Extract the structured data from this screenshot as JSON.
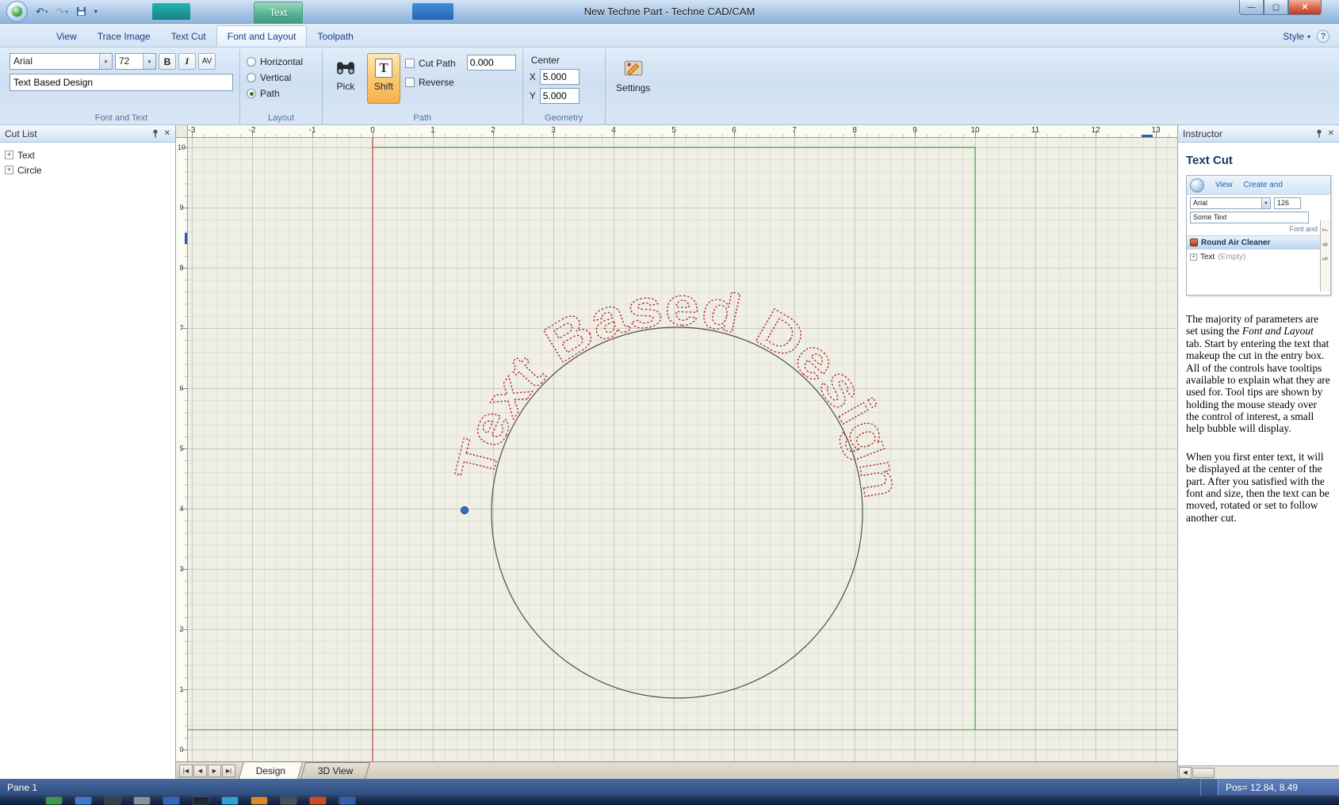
{
  "window": {
    "title": "New Techne Part - Techne CAD/CAM",
    "contextual_tab": "Text",
    "style_label": "Style"
  },
  "ribbon": {
    "tabs": [
      {
        "label": "View",
        "active": false
      },
      {
        "label": "Trace Image",
        "active": false
      },
      {
        "label": "Text Cut",
        "active": false
      },
      {
        "label": "Font and Layout",
        "active": true
      },
      {
        "label": "Toolpath",
        "active": false
      }
    ],
    "font_group": {
      "label": "Font and Text",
      "font_name": "Arial",
      "font_size": "72",
      "bold": "B",
      "italic": "I",
      "kern": "AV",
      "text_value": "Text Based Design"
    },
    "layout_group": {
      "label": "Layout",
      "options": [
        {
          "label": "Horizontal",
          "selected": false
        },
        {
          "label": "Vertical",
          "selected": false
        },
        {
          "label": "Path",
          "selected": true
        }
      ]
    },
    "path_group": {
      "label": "Path",
      "pick": "Pick",
      "shift": "Shift",
      "cut_path": "Cut Path",
      "reverse": "Reverse",
      "offset": "0.000"
    },
    "geometry_group": {
      "label": "Geometry",
      "center": "Center",
      "x_label": "X",
      "x_value": "5.000",
      "y_label": "Y",
      "y_value": "5.000"
    },
    "settings_label": "Settings"
  },
  "cut_list": {
    "title": "Cut List",
    "items": [
      {
        "label": "Text"
      },
      {
        "label": "Circle"
      }
    ]
  },
  "canvas": {
    "arc_text": "Text Based Design",
    "ruler_h": [
      -3,
      -2,
      -1,
      0,
      1,
      2,
      3,
      4,
      5,
      6,
      7,
      8,
      9,
      10,
      11,
      12,
      13
    ],
    "ruler_v": [
      10,
      9,
      8,
      7,
      6,
      5,
      4,
      3,
      2,
      1,
      0
    ]
  },
  "instructor": {
    "title": "Instructor",
    "heading": "Text Cut",
    "mini": {
      "tab_view": "View",
      "tab_create": "Create and",
      "font_name": "Arial",
      "font_size": "126",
      "text_value": "Some Text",
      "group_label": "Font and",
      "section_title": "Round Air Cleaner",
      "tree_label": "Text",
      "tree_suffix": "(Empty)",
      "ruler_digits": [
        "7",
        "6",
        "5"
      ]
    },
    "para1_a": "The majority of parameters are set using the ",
    "para1_em": "Font and Layout",
    "para1_b": " tab. Start by entering the text that makeup the cut in the entry box.  All of the controls have tooltips available to explain what they are used for.  Tool tips are shown by holding the mouse steady over the control of interest, a small help bubble will display.",
    "para2": "When you first enter text, it will be displayed at the center of the part.  After you satisfied with the font and size, then the text can be moved, rotated or set to follow another cut."
  },
  "bottom_tabs": {
    "tabs": [
      {
        "label": "Design",
        "active": true
      },
      {
        "label": "3D View",
        "active": false
      }
    ]
  },
  "status": {
    "pane": "Pane 1",
    "pos": "Pos= 12.84, 8.49"
  },
  "taskbar": {
    "icons": [
      "#3c9a46",
      "#3a7bd0",
      "#3b3f46",
      "#8a9098",
      "#2f66c2",
      "#23272e",
      "#2aa3d8",
      "#e2861f",
      "#4a4f57",
      "#d2491e",
      "#2f5fb0"
    ]
  },
  "colors": {
    "selected_button_orange": "#f5b04c",
    "cut_text_red": "#b22222",
    "guide_green": "#2e9b2e",
    "origin_line_red": "#c23030",
    "status_bar_blue": "#2e4d7e",
    "contextual_tab_teal": "#3d9a7c"
  }
}
